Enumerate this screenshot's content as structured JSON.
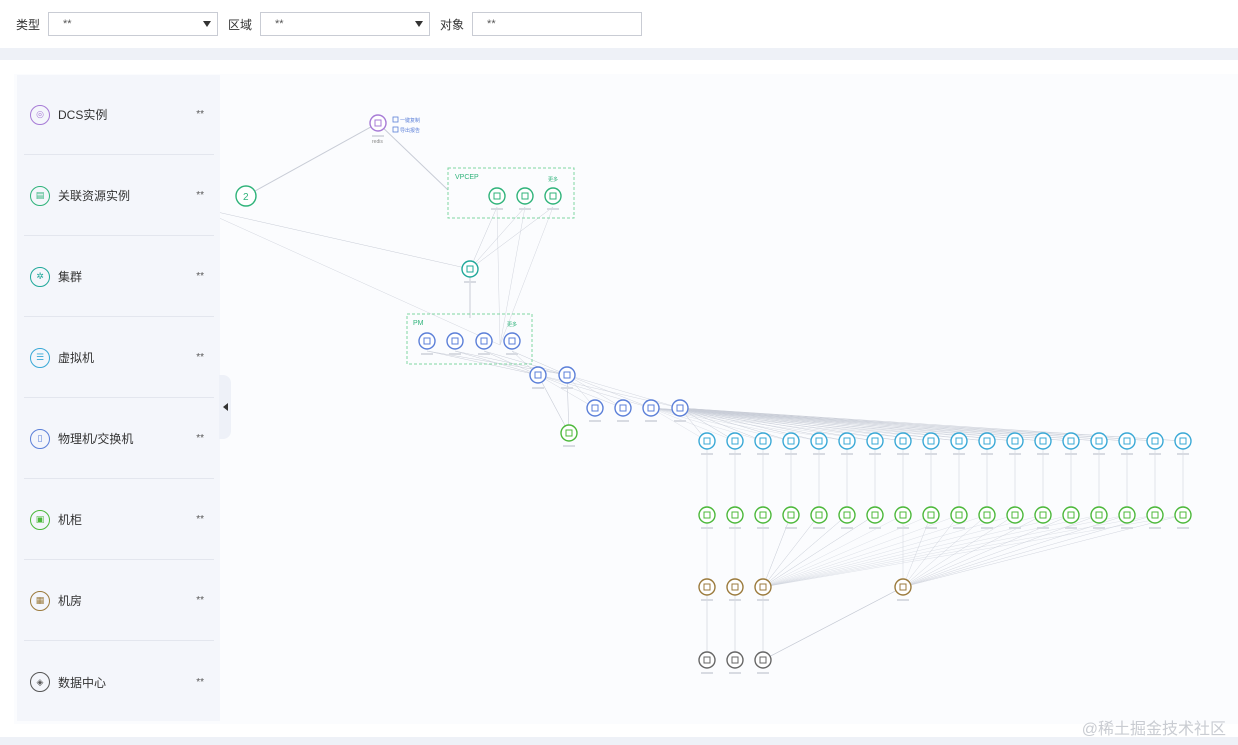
{
  "filters": [
    {
      "label": "类型",
      "value": "**"
    },
    {
      "label": "区域",
      "value": "**"
    },
    {
      "label": "对象",
      "value": "**"
    }
  ],
  "sidebar": {
    "items": [
      {
        "label": "DCS实例",
        "count": "**",
        "color": "#a77bd6",
        "icon": "instance-icon"
      },
      {
        "label": "关联资源实例",
        "count": "**",
        "color": "#2fb37a",
        "icon": "resource-icon"
      },
      {
        "label": "集群",
        "count": "**",
        "color": "#1fa89a",
        "icon": "cluster-icon"
      },
      {
        "label": "虚拟机",
        "count": "**",
        "color": "#39a8d6",
        "icon": "vm-icon"
      },
      {
        "label": "物理机/交换机",
        "count": "**",
        "color": "#5b7fd8",
        "icon": "server-icon"
      },
      {
        "label": "机柜",
        "count": "**",
        "color": "#4cb83a",
        "icon": "cabinet-icon"
      },
      {
        "label": "机房",
        "count": "**",
        "color": "#9b7a3c",
        "icon": "room-icon"
      },
      {
        "label": "数据中心",
        "count": "**",
        "color": "#555555",
        "icon": "datacenter-icon"
      }
    ]
  },
  "topology": {
    "root_label": "redis",
    "root_actions": [
      "一键复制",
      "导出报告"
    ],
    "badge_count": "2",
    "vpcep_label": "VPCEP",
    "pm_label": "PM",
    "group_more": "更多",
    "colors": {
      "purple": "#a77bd6",
      "green": "#2fb37a",
      "teal": "#1fa89a",
      "blue": "#5b7fd8",
      "cyan": "#39a8d6",
      "lime": "#4cb83a",
      "brown": "#9b7a3c",
      "gray": "#666666",
      "line": "#c8ccd6"
    }
  },
  "watermark": "@稀土掘金技术社区"
}
